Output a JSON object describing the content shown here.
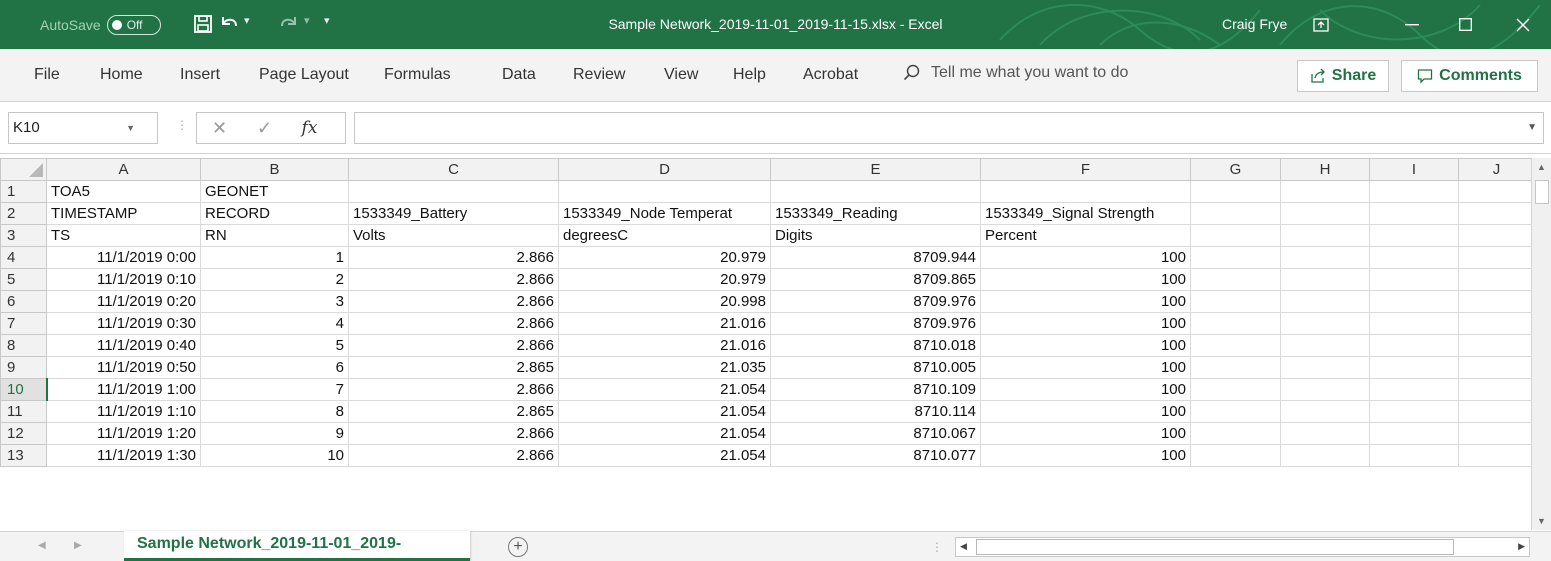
{
  "titlebar": {
    "autosave_label": "AutoSave",
    "autosave_state": "Off",
    "doc_title": "Sample Network_2019-11-01_2019-11-15.xlsx  -  Excel",
    "user_name": "Craig Frye",
    "accent_color": "#217346"
  },
  "menu": {
    "items": [
      "File",
      "Home",
      "Insert",
      "Page Layout",
      "Formulas",
      "Data",
      "Review",
      "View",
      "Help",
      "Acrobat"
    ],
    "tell_me": "Tell me what you want to do",
    "share_label": "Share",
    "comments_label": "Comments"
  },
  "formula_bar": {
    "name_box": "K10",
    "fx_label": "fx",
    "formula": ""
  },
  "sheet": {
    "columns": [
      "A",
      "B",
      "C",
      "D",
      "E",
      "F",
      "G",
      "H",
      "I",
      "J"
    ],
    "active_row": "10",
    "rows": [
      {
        "n": "1",
        "cells": [
          "TOA5",
          "GEONET",
          "",
          "",
          "",
          "",
          "",
          "",
          "",
          ""
        ]
      },
      {
        "n": "2",
        "cells": [
          "TIMESTAMP",
          "RECORD",
          "1533349_Battery",
          "1533349_Node Temperat",
          "1533349_Reading",
          "1533349_Signal Strength",
          "",
          "",
          "",
          ""
        ]
      },
      {
        "n": "3",
        "cells": [
          "TS",
          "RN",
          "Volts",
          "degreesC",
          "Digits",
          "Percent",
          "",
          "",
          "",
          ""
        ]
      },
      {
        "n": "4",
        "cells": [
          "11/1/2019 0:00",
          "1",
          "2.866",
          "20.979",
          "8709.944",
          "100",
          "",
          "",
          "",
          ""
        ]
      },
      {
        "n": "5",
        "cells": [
          "11/1/2019 0:10",
          "2",
          "2.866",
          "20.979",
          "8709.865",
          "100",
          "",
          "",
          "",
          ""
        ]
      },
      {
        "n": "6",
        "cells": [
          "11/1/2019 0:20",
          "3",
          "2.866",
          "20.998",
          "8709.976",
          "100",
          "",
          "",
          "",
          ""
        ]
      },
      {
        "n": "7",
        "cells": [
          "11/1/2019 0:30",
          "4",
          "2.866",
          "21.016",
          "8709.976",
          "100",
          "",
          "",
          "",
          ""
        ]
      },
      {
        "n": "8",
        "cells": [
          "11/1/2019 0:40",
          "5",
          "2.866",
          "21.016",
          "8710.018",
          "100",
          "",
          "",
          "",
          ""
        ]
      },
      {
        "n": "9",
        "cells": [
          "11/1/2019 0:50",
          "6",
          "2.865",
          "21.035",
          "8710.005",
          "100",
          "",
          "",
          "",
          ""
        ]
      },
      {
        "n": "10",
        "cells": [
          "11/1/2019 1:00",
          "7",
          "2.866",
          "21.054",
          "8710.109",
          "100",
          "",
          "",
          "",
          ""
        ]
      },
      {
        "n": "11",
        "cells": [
          "11/1/2019 1:10",
          "8",
          "2.865",
          "21.054",
          "8710.114",
          "100",
          "",
          "",
          "",
          ""
        ]
      },
      {
        "n": "12",
        "cells": [
          "11/1/2019 1:20",
          "9",
          "2.866",
          "21.054",
          "8710.067",
          "100",
          "",
          "",
          "",
          ""
        ]
      },
      {
        "n": "13",
        "cells": [
          "11/1/2019 1:30",
          "10",
          "2.866",
          "21.054",
          "8710.077",
          "100",
          "",
          "",
          "",
          ""
        ]
      }
    ]
  },
  "tabs": {
    "active_sheet": "Sample Network_2019-11-01_2019-"
  }
}
